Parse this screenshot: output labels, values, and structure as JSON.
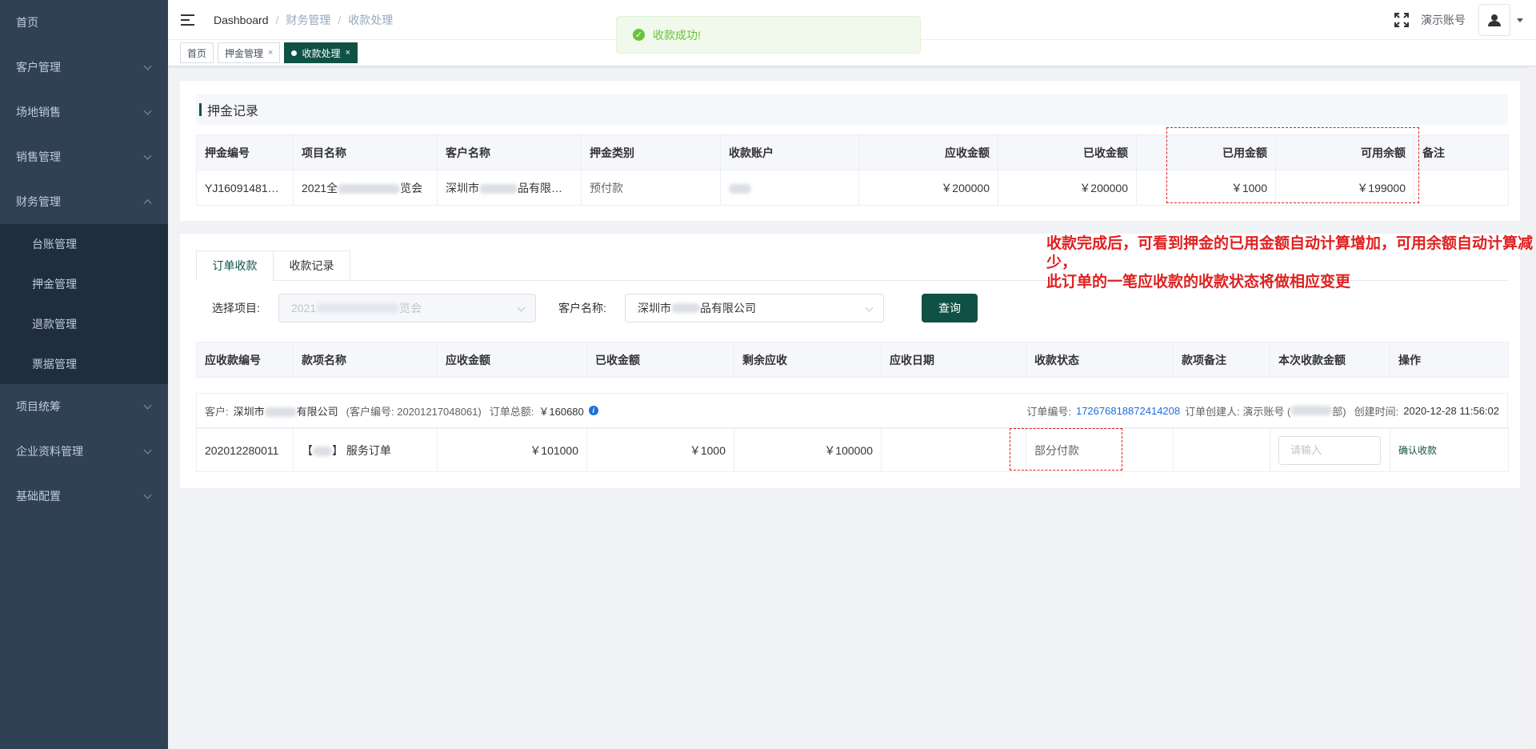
{
  "sidebar": {
    "items": [
      {
        "label": "首页"
      },
      {
        "label": "客户管理"
      },
      {
        "label": "场地销售"
      },
      {
        "label": "销售管理"
      },
      {
        "label": "财务管理"
      },
      {
        "label": "项目统筹"
      },
      {
        "label": "企业资料管理"
      },
      {
        "label": "基础配置"
      }
    ],
    "finance_sub": [
      {
        "label": "台账管理"
      },
      {
        "label": "押金管理"
      },
      {
        "label": "退款管理"
      },
      {
        "label": "票据管理"
      }
    ]
  },
  "navbar": {
    "breadcrumb": [
      "Dashboard",
      "财务管理",
      "收款处理"
    ],
    "account": "演示账号"
  },
  "tags": [
    {
      "label": "首页"
    },
    {
      "label": "押金管理"
    },
    {
      "label": "收款处理"
    }
  ],
  "toast": {
    "message": "收款成功!",
    "color": "#67c23a"
  },
  "deposit": {
    "title": "押金记录",
    "columns": [
      "押金编号",
      "项目名称",
      "客户名称",
      "押金类别",
      "收款账户",
      "应收金额",
      "已收金额",
      "已用金额",
      "可用余额",
      "备注"
    ],
    "row": {
      "id": "YJ16091481…",
      "project_prefix": "2021全",
      "project_suffix": "览会",
      "customer_prefix": "深圳市",
      "customer_suffix": "品有限公司",
      "category": "预付款",
      "receivable": "￥200000",
      "received": "￥200000",
      "used": "￥1000",
      "available": "￥199000"
    }
  },
  "annotation": {
    "line1": "收款完成后，可看到押金的已用金额自动计算增加，可用余额自动计算减少，",
    "line2": "此订单的一笔应收款的收款状态将做相应变更",
    "color": "#e02020"
  },
  "tabs": [
    "订单收款",
    "收款记录"
  ],
  "filters": {
    "project_label": "选择项目:",
    "project_prefix": "2021",
    "project_suffix": "览会",
    "customer_label": "客户名称:",
    "customer_prefix": "深圳市",
    "customer_suffix": "品有限公司",
    "query": "查询"
  },
  "orders": {
    "columns": [
      "应收款编号",
      "款项名称",
      "应收金额",
      "已收金额",
      "剩余应收",
      "应收日期",
      "收款状态",
      "款项备注",
      "本次收款金额",
      "操作"
    ],
    "info": {
      "customer_label": "客户:",
      "customer_prefix": "深圳市",
      "customer_suffix": "有限公司",
      "code": "(客户编号: 20201217048061)",
      "total_label": "订单总额:",
      "total": "￥160680",
      "order_no_label": "订单编号:",
      "order_no": "172676818872414208",
      "creator_label": "订单创建人: 演示账号 (",
      "creator_suffix": "部)",
      "created_label": "创建时间:",
      "created": "2020-12-28 11:56:02"
    },
    "row": {
      "id": "202012280011",
      "name_open": "【",
      "name_close": "】 服务订单",
      "receivable": "￥101000",
      "received": "￥1000",
      "remaining": "￥100000",
      "due_date": "",
      "status": "部分付款",
      "remark": "",
      "input_placeholder": "请输入",
      "action": "确认收款"
    }
  },
  "colors": {
    "sidebar": "#304156",
    "accent": "#0f5245",
    "link": "#1e6fd9"
  }
}
